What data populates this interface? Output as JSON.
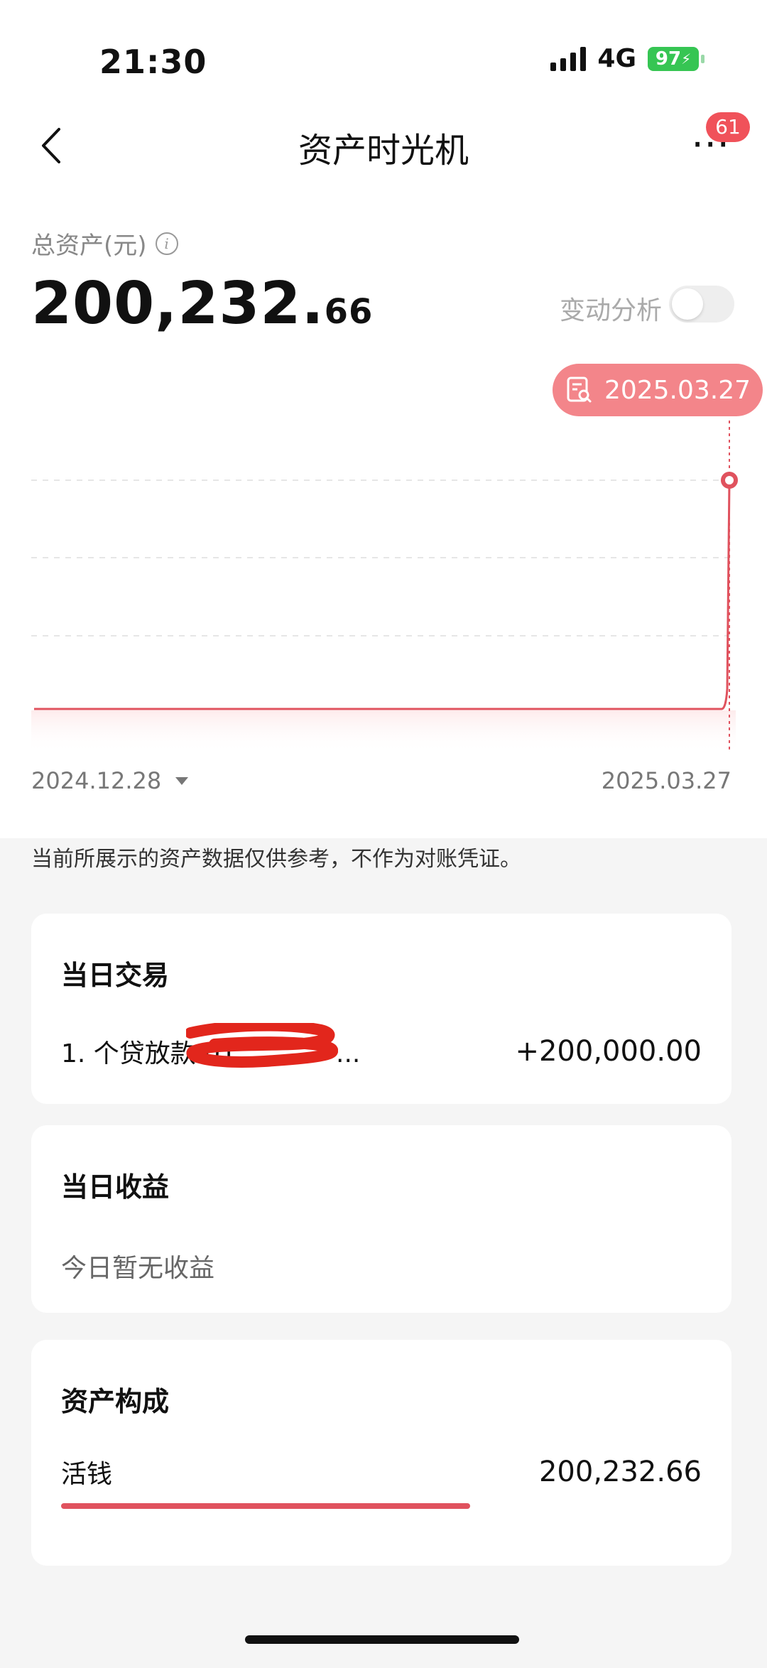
{
  "status_bar": {
    "time": "21:30",
    "network": "4G",
    "battery": "97"
  },
  "header": {
    "title": "资产时光机",
    "notification_count": "61"
  },
  "total": {
    "label": "总资产(元)",
    "amount_int": "200,232.",
    "amount_dec": "66",
    "change_analysis_label": "变动分析",
    "change_analysis_on": false
  },
  "chart_data": {
    "type": "line",
    "x_start_label": "2024.12.28",
    "x_end_label": "2025.03.27",
    "selected_date": "2025.03.27",
    "series_color": "#e0525e"
  },
  "disclaimer": "当前所展示的资产数据仅供参考，不作为对账凭证。",
  "daily_transactions": {
    "title": "当日交易",
    "items": [
      {
        "label": "1. 个贷放款 01",
        "suffix": "...",
        "amount": "+200,000.00"
      }
    ]
  },
  "daily_income": {
    "title": "当日收益",
    "empty_text": "今日暂无收益"
  },
  "asset_composition": {
    "title": "资产构成",
    "items": [
      {
        "name": "活钱",
        "value": "200,232.66",
        "share": 1.0
      }
    ]
  }
}
